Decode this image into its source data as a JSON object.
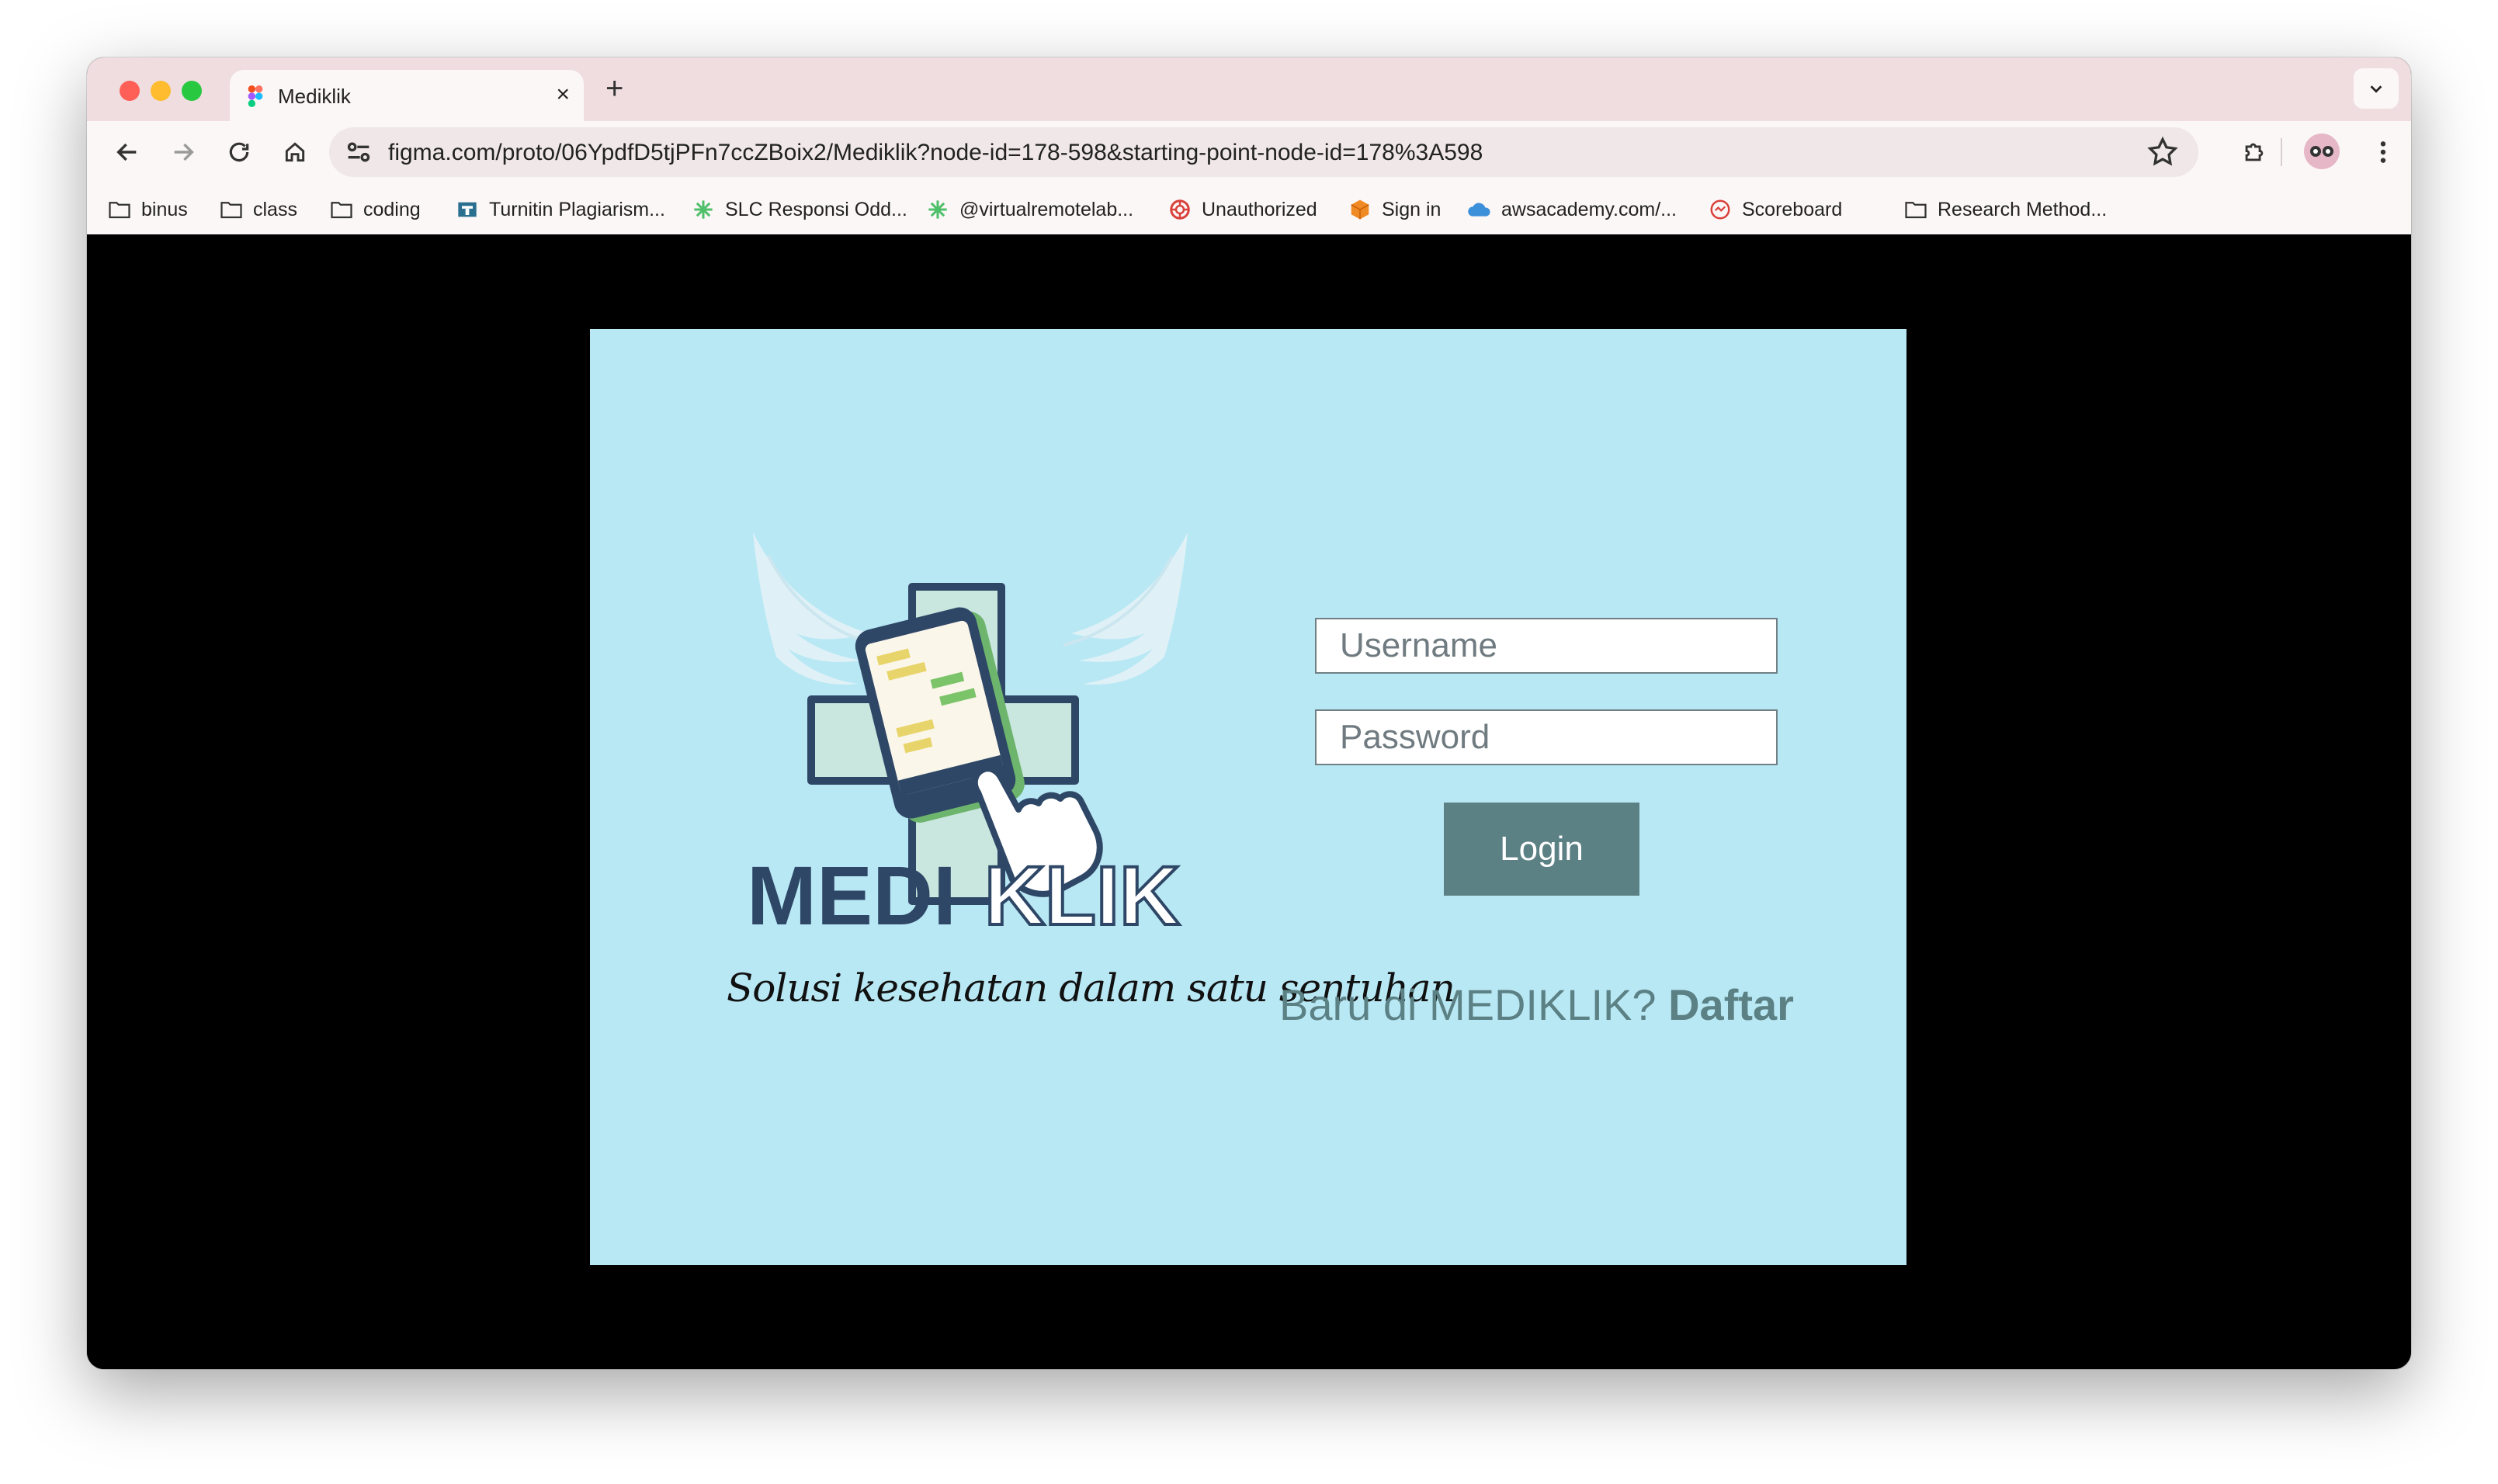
{
  "browser": {
    "tab_title": "Mediklik",
    "tab_close": "×",
    "new_tab": "+",
    "url": "figma.com/proto/06YpdfD5tjPFn7ccZBoix2/Mediklik?node-id=178-598&starting-point-node-id=178%3A598",
    "bookmarks": [
      {
        "label": "binus",
        "icon": "folder-icon"
      },
      {
        "label": "class",
        "icon": "folder-icon"
      },
      {
        "label": "coding",
        "icon": "folder-icon"
      },
      {
        "label": "Turnitin Plagiarism...",
        "icon": "turnitin-icon"
      },
      {
        "label": "SLC Responsi Odd...",
        "icon": "sparkle-icon"
      },
      {
        "label": "@virtualremotelab...",
        "icon": "sparkle-icon"
      },
      {
        "label": "Unauthorized",
        "icon": "lifebuoy-icon"
      },
      {
        "label": "Sign in",
        "icon": "cube-icon"
      },
      {
        "label": "awsacademy.com/...",
        "icon": "cloud-icon"
      },
      {
        "label": "Scoreboard",
        "icon": "scoreboard-icon"
      },
      {
        "label": "Research Method...",
        "icon": "folder-icon"
      }
    ]
  },
  "login": {
    "logo_text_dark": "MEDI",
    "logo_text_light": "KLIK",
    "tagline": "Solusi kesehatan dalam satu sentuhan",
    "username_placeholder": "Username",
    "password_placeholder": "Password",
    "login_label": "Login",
    "register_prompt": "Baru di MEDIKLIK?",
    "register_link": "Daftar"
  },
  "colors": {
    "frame_bg": "#b9e8f5",
    "button": "#5c8185",
    "logo_navy": "#2e4766"
  }
}
